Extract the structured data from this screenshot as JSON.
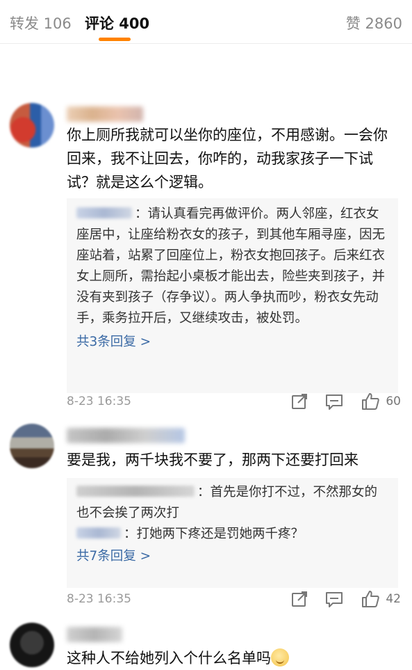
{
  "tabs": {
    "repost": "转发 106",
    "comments": "评论 400",
    "likes": "赞 2860"
  },
  "comments": [
    {
      "text": "你上厕所我就可以坐你的座位，不用感谢。一会你回来，我不让回去，你咋的，动我家孩子一下试试？就是这么个逻辑。",
      "replies": [
        "：请认真看完再做评价。两人邻座，红衣女座居中，让座给粉衣女的孩子，到其他车厢寻座，因无座站着，站累了回座位上，粉衣女抱回孩子。后来红衣女上厕所，需抬起小桌板才能出去，险些夹到孩子，并没有夹到孩子（存争议）。两人争执而吵，粉衣女先动手，乘务拉开后，又继续攻击，被处罚。"
      ],
      "more_replies": "共3条回复 >",
      "time": "8-23 16:35",
      "likes": "60"
    },
    {
      "text": "要是我，两千块我不要了，那两下还要打回来",
      "replies": [
        "：首先是你打不过，不然那女的也不会挨了两次打",
        "：打她两下疼还是罚她两千疼？"
      ],
      "more_replies": "共7条回复 >",
      "time": "8-23 16:35",
      "likes": "42"
    },
    {
      "text": "这种人不给她列入个什么名单吗"
    }
  ],
  "colors": {
    "accent": "#ff8200",
    "link": "#3b6aa5"
  }
}
